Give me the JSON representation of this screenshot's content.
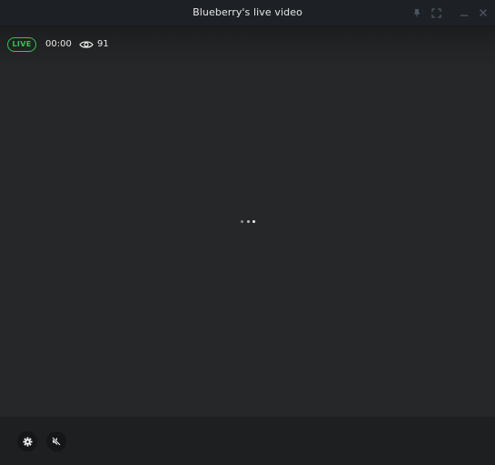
{
  "window": {
    "title": "Blueberry's live video"
  },
  "titlebar_icons": {
    "pin": "pin-icon",
    "expand": "expand-icon",
    "minimize": "minimize-icon",
    "close": "close-icon"
  },
  "stream": {
    "live_label": "LIVE",
    "elapsed": "00:00",
    "viewer_count": "91",
    "viewer_icon": "eye-icon",
    "status": "loading"
  },
  "controls": {
    "settings_icon": "gear-icon",
    "mute_icon": "speaker-muted-icon"
  },
  "colors": {
    "live_accent": "#31c552",
    "titlebar": "#1d2125",
    "video_background": "#262728",
    "control_bar": "#1e1f20"
  }
}
